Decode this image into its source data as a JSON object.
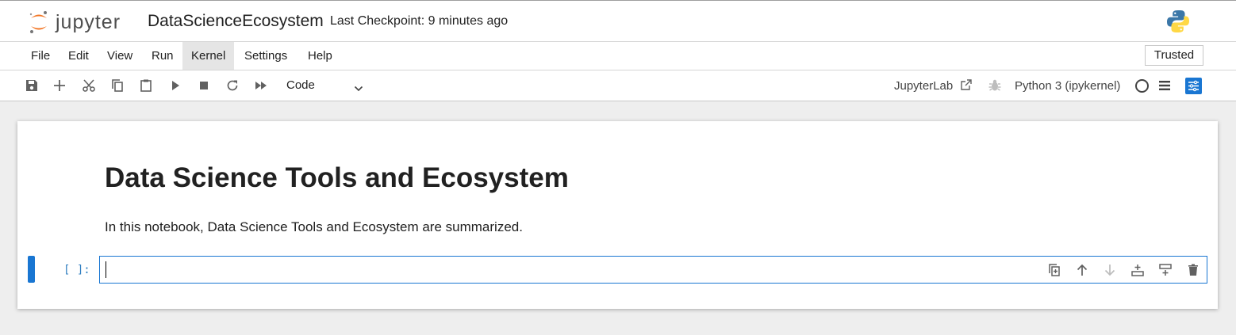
{
  "header": {
    "logo_text": "jupyter",
    "notebook_title": "DataScienceEcosystem",
    "checkpoint": "Last Checkpoint: 9 minutes ago",
    "kernel_logo": "python-logo-icon"
  },
  "menu": {
    "items": [
      "File",
      "Edit",
      "View",
      "Run",
      "Kernel",
      "Settings",
      "Help"
    ],
    "active": "Kernel",
    "trusted_label": "Trusted"
  },
  "toolbar": {
    "icons": [
      "save-icon",
      "add-icon",
      "cut-icon",
      "copy-icon",
      "paste-icon",
      "run-icon",
      "stop-icon",
      "restart-icon",
      "fast-forward-icon"
    ],
    "cell_type": "Code",
    "jupyterlab_label": "JupyterLab",
    "kernel_name": "Python 3 (ipykernel)"
  },
  "notebook": {
    "markdown_heading": "Data Science Tools and Ecosystem",
    "markdown_text": "In this notebook, Data Science Tools and Ecosystem are summarized.",
    "code_prompt": "[ ]:",
    "code_value": "",
    "cell_tool_icons": [
      "duplicate-icon",
      "move-up-icon",
      "move-down-icon",
      "insert-above-icon",
      "insert-below-icon",
      "delete-icon"
    ]
  },
  "colors": {
    "accent": "#1976d2",
    "jupyter_orange": "#f37726",
    "prompt_blue": "#307fc1"
  }
}
